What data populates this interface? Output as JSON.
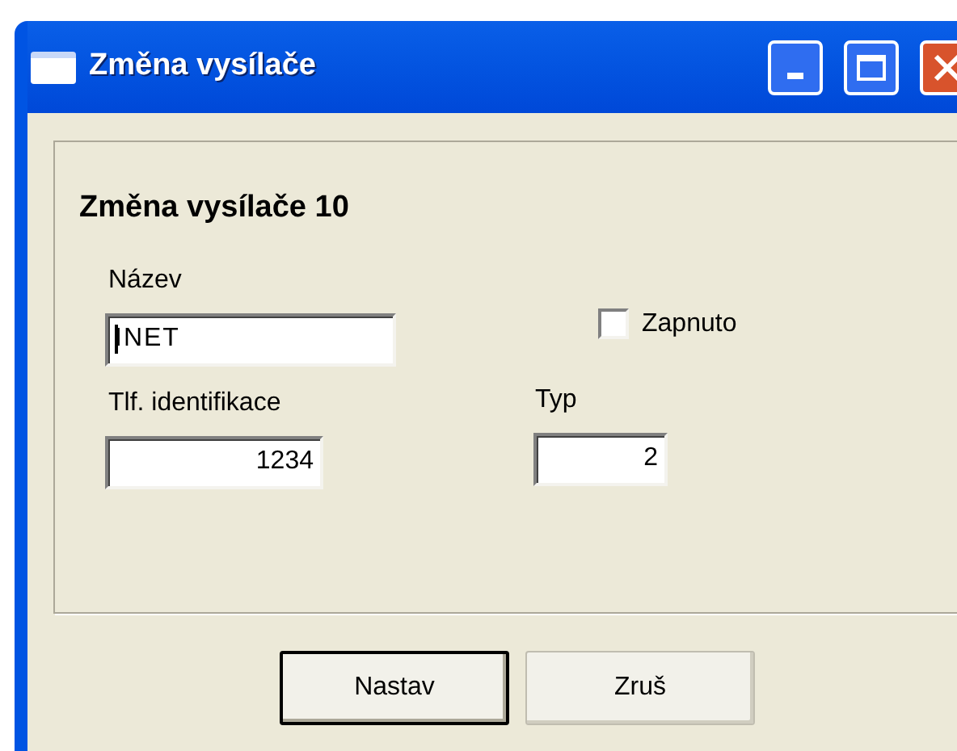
{
  "window": {
    "title": "Změna vysílače"
  },
  "heading": "Změna vysílače 10",
  "name_field": {
    "label": "Název",
    "value": "INET",
    "focused": true
  },
  "enabled_checkbox": {
    "label": "Zapnuto",
    "checked": false
  },
  "phone_field": {
    "label": "Tlf. identifikace",
    "value": "1234"
  },
  "type_field": {
    "label": "Typ",
    "value": "2"
  },
  "buttons": [
    {
      "label": "Nastav",
      "default": true
    },
    {
      "label": "Zruš",
      "default": false
    }
  ]
}
